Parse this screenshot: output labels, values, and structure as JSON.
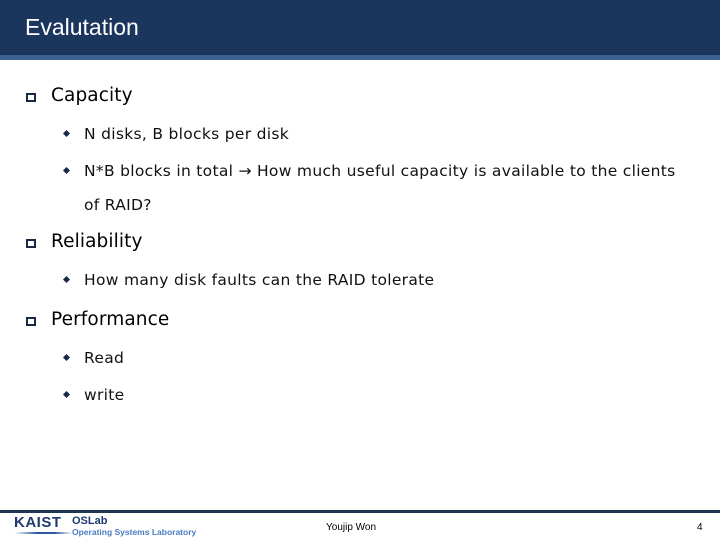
{
  "slide": {
    "title": "Evalutation",
    "sections": [
      {
        "heading": "Capacity",
        "bullets": [
          "N disks, B blocks per disk",
          "N*B blocks in total → How much useful capacity is available to the clients",
          "of RAID?"
        ]
      },
      {
        "heading": "Reliability",
        "bullets": [
          "How many disk faults can the RAID tolerate"
        ]
      },
      {
        "heading": "Performance",
        "bullets": [
          "Read",
          "write"
        ]
      }
    ]
  },
  "footer": {
    "logo_primary": "KAIST",
    "logo_lab": "OSLab",
    "logo_lab_full": "Operating Systems Laboratory",
    "author": "Youjip Won",
    "page_number": "4"
  },
  "colors": {
    "header_bg": "#1a365d",
    "header_stripe": "#3b6190",
    "bullet": "#1a2a44",
    "footer_line": "#1f3552",
    "logo_blue": "#1f3a6e",
    "logo_light_blue": "#4a7cc0"
  }
}
